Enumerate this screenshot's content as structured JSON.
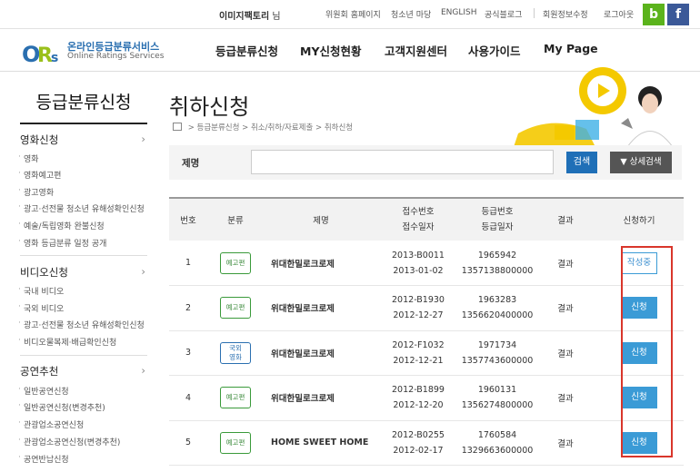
{
  "topbar": {
    "user_name": "이미지팩토리",
    "user_suffix": "님",
    "links": [
      "위원회 홈페이지",
      "청소년 마당",
      "ENGLISH",
      "공식블로그",
      "회원정보수정",
      "로그아웃"
    ],
    "blog_btn": "b",
    "facebook_btn": "f"
  },
  "logo": {
    "title": "온라인등급분류서비스",
    "subtitle": "Online Ratings Services"
  },
  "gnav": [
    "등급분류신청",
    "MY신청현황",
    "고객지원센터",
    "사용가이드",
    "My Page"
  ],
  "sidebar": {
    "title": "등급분류신청",
    "cats": [
      {
        "label": "영화신청",
        "items": [
          "영화",
          "영화예고편",
          "광고영화",
          "광고·선전물 청소년 유해성확인신청",
          "예술/독립영화 완불신청",
          "영화 등급분류 일정 공개"
        ]
      },
      {
        "label": "비디오신청",
        "items": [
          "국내 비디오",
          "국외 비디오",
          "광고·선전물 청소년 유해성확인신청",
          "비디오물복제·배급확인신청"
        ]
      },
      {
        "label": "공연추천",
        "items": [
          "일반공연신청",
          "일반공연신청(변경추천)",
          "관광업소공연신청",
          "관광업소공연신청(변경추천)",
          "공연반납신청"
        ]
      }
    ],
    "arrow": "›"
  },
  "page": {
    "title": "취하신청",
    "breadcrumb": [
      "등급분류신청",
      "취소/취하/자료제출",
      "취하신청"
    ]
  },
  "search": {
    "label": "제명",
    "value": "",
    "search_btn": "검색",
    "detail_btn": "▼ 상세검색"
  },
  "table": {
    "headers": {
      "no": "번호",
      "type": "분류",
      "title": "제명",
      "recv_no": "접수번호",
      "recv_date": "접수일자",
      "grade_no": "등급번호",
      "grade_date": "등급일자",
      "result": "결과",
      "apply": "신청하기"
    },
    "rows": [
      {
        "no": "1",
        "type": "예고편",
        "title": "위대한밀로크로제",
        "recv_no": "2013-B0011",
        "recv_date": "2013-01-02",
        "grade_no": "1965942",
        "grade_date": "1357138800000",
        "result": "결과",
        "apply": "작성중",
        "apply_style": "out"
      },
      {
        "no": "2",
        "type": "예고편",
        "title": "위대한밀로크로제",
        "recv_no": "2012-B1930",
        "recv_date": "2012-12-27",
        "grade_no": "1963283",
        "grade_date": "1356620400000",
        "result": "결과",
        "apply": "신청",
        "apply_style": "fill"
      },
      {
        "no": "3",
        "type": "국외영화",
        "type_lines": [
          "국외",
          "영화"
        ],
        "title": "위대한밀로크로제",
        "recv_no": "2012-F1032",
        "recv_date": "2012-12-21",
        "grade_no": "1971734",
        "grade_date": "1357743600000",
        "result": "결과",
        "apply": "신청",
        "apply_style": "fill"
      },
      {
        "no": "4",
        "type": "예고편",
        "title": "위대한밀로크로제",
        "recv_no": "2012-B1899",
        "recv_date": "2012-12-20",
        "grade_no": "1960131",
        "grade_date": "1356274800000",
        "result": "결과",
        "apply": "신청",
        "apply_style": "fill"
      },
      {
        "no": "5",
        "type": "예고편",
        "title": "HOME SWEET HOME",
        "recv_no": "2012-B0255",
        "recv_date": "2012-02-17",
        "grade_no": "1760584",
        "grade_date": "1329663600000",
        "result": "결과",
        "apply": "신청",
        "apply_style": "fill"
      }
    ]
  },
  "colors": {
    "accent": "#1f6fb7",
    "apply_btn": "#3b9bd6",
    "highlight": "#d9362b",
    "blog": "#5bb31c",
    "facebook": "#3b5998",
    "play": "#f4c900"
  }
}
